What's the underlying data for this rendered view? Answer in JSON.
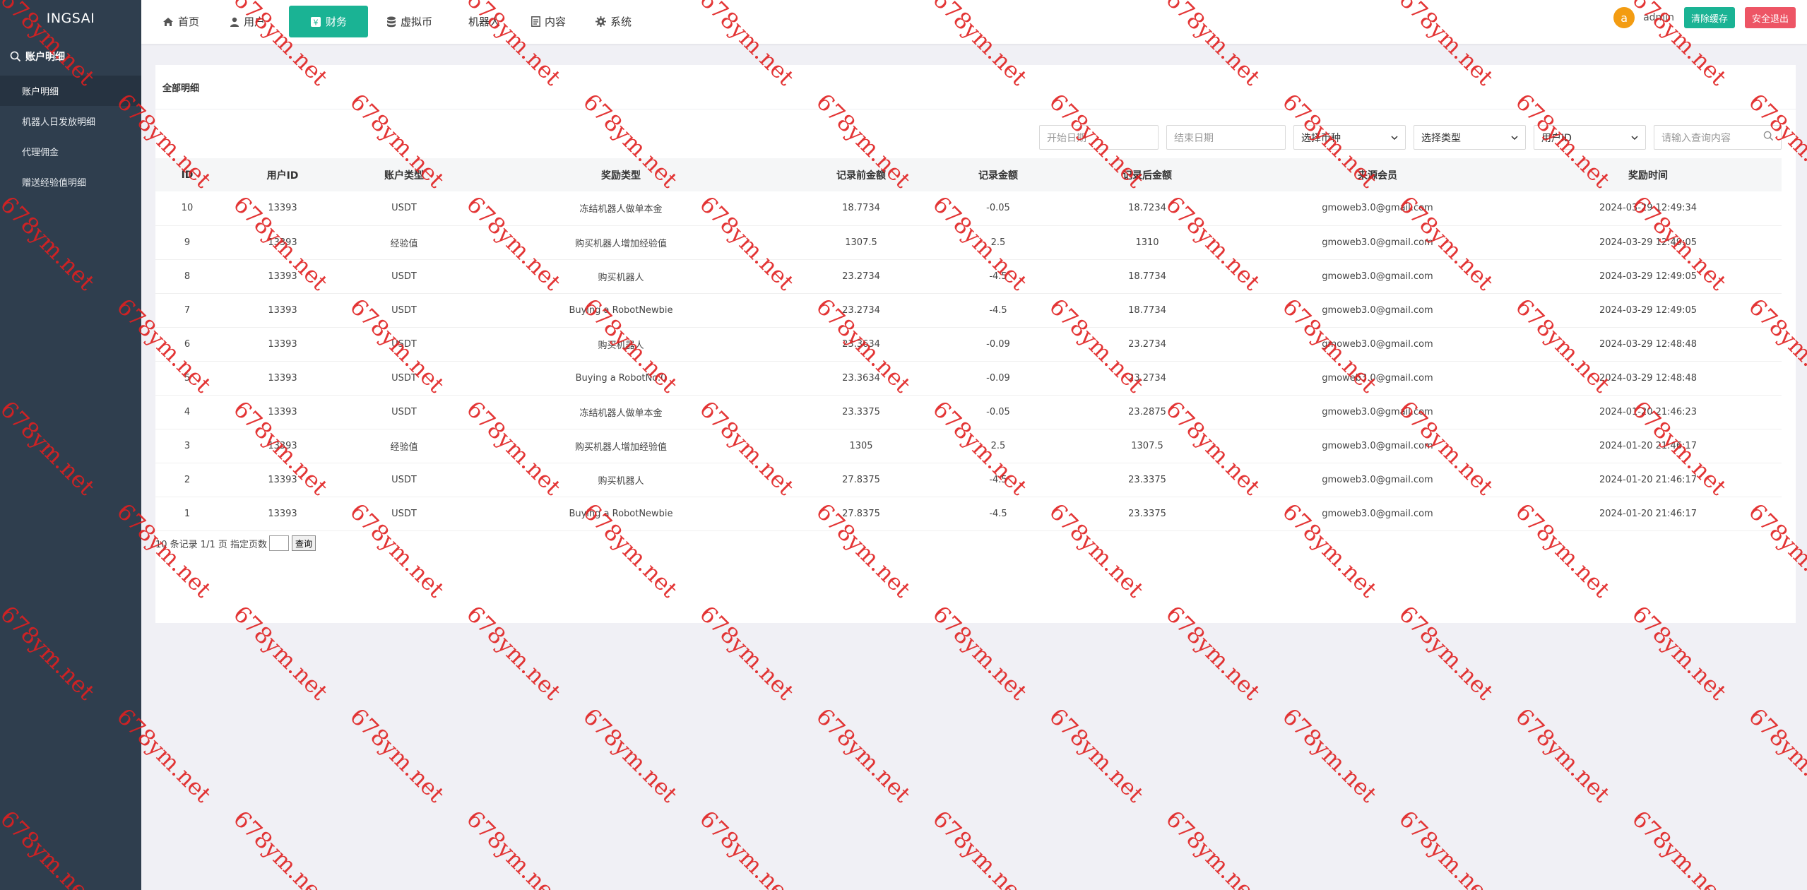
{
  "sidebar": {
    "brand": "INGSAI",
    "section": "账户明细",
    "items": [
      {
        "label": "账户明细",
        "active": true
      },
      {
        "label": "机器人日发放明细",
        "active": false
      },
      {
        "label": "代理佣金",
        "active": false
      },
      {
        "label": "赠送经验值明细",
        "active": false
      }
    ]
  },
  "topnav": {
    "items": [
      {
        "label": "首页",
        "icon": "home-icon"
      },
      {
        "label": "用户",
        "icon": "user-icon"
      },
      {
        "label": "财务",
        "icon": "finance-icon",
        "active": true
      },
      {
        "label": "虚拟币",
        "icon": "database-icon"
      },
      {
        "label": "机器人",
        "icon": ""
      },
      {
        "label": "内容",
        "icon": "document-icon"
      },
      {
        "label": "系统",
        "icon": "gear-icon"
      }
    ],
    "avatar_letter": "a",
    "admin_name": "admin",
    "clear_cache_label": "清除缓存",
    "logout_label": "安全退出"
  },
  "card": {
    "title": "全部明细"
  },
  "filters": {
    "start_date_placeholder": "开始日期",
    "end_date_placeholder": "结束日期",
    "currency_select": "选择币种",
    "type_select": "选择类型",
    "userid_select": "用户ID",
    "search_placeholder": "请输入查询内容"
  },
  "table": {
    "headers": [
      "ID",
      "用户ID",
      "账户类型",
      "奖励类型",
      "记录前金额",
      "记录金额",
      "记录后金额",
      "来源会员",
      "奖励时间"
    ],
    "rows": [
      [
        "10",
        "13393",
        "USDT",
        "冻结机器人做单本金",
        "18.7734",
        "-0.05",
        "18.7234",
        "gmoweb3.0@gmail.com",
        "2024-03-29 12:49:34"
      ],
      [
        "9",
        "13393",
        "经验值",
        "购买机器人增加经验值",
        "1307.5",
        "2.5",
        "1310",
        "gmoweb3.0@gmail.com",
        "2024-03-29 12:49:05"
      ],
      [
        "8",
        "13393",
        "USDT",
        "购买机器人",
        "23.2734",
        "-4.5",
        "18.7734",
        "gmoweb3.0@gmail.com",
        "2024-03-29 12:49:05"
      ],
      [
        "7",
        "13393",
        "USDT",
        "Buying a RobotNewbie",
        "23.2734",
        "-4.5",
        "18.7734",
        "gmoweb3.0@gmail.com",
        "2024-03-29 12:49:05"
      ],
      [
        "6",
        "13393",
        "USDT",
        "购买机器人",
        "23.3634",
        "-0.09",
        "23.2734",
        "gmoweb3.0@gmail.com",
        "2024-03-29 12:48:48"
      ],
      [
        "5",
        "13393",
        "USDT",
        "Buying a RobotNo.0",
        "23.3634",
        "-0.09",
        "23.2734",
        "gmoweb3.0@gmail.com",
        "2024-03-29 12:48:48"
      ],
      [
        "4",
        "13393",
        "USDT",
        "冻结机器人做单本金",
        "23.3375",
        "-0.05",
        "23.2875",
        "gmoweb3.0@gmail.com",
        "2024-01-20 21:46:23"
      ],
      [
        "3",
        "13393",
        "经验值",
        "购买机器人增加经验值",
        "1305",
        "2.5",
        "1307.5",
        "gmoweb3.0@gmail.com",
        "2024-01-20 21:46:17"
      ],
      [
        "2",
        "13393",
        "USDT",
        "购买机器人",
        "27.8375",
        "-4.5",
        "23.3375",
        "gmoweb3.0@gmail.com",
        "2024-01-20 21:46:17"
      ],
      [
        "1",
        "13393",
        "USDT",
        "Buying a RobotNewbie",
        "27.8375",
        "-4.5",
        "23.3375",
        "gmoweb3.0@gmail.com",
        "2024-01-20 21:46:17"
      ]
    ]
  },
  "pager": {
    "summary": "10 条记录 1/1 页 指定页数",
    "go_label": "查询"
  },
  "watermark": {
    "text": "678ym.net",
    "color": "#e02020"
  },
  "colors": {
    "accent": "#1ab394",
    "danger": "#ed5565",
    "sidebar": "#2f3e4e",
    "avatar": "#f39c12"
  }
}
